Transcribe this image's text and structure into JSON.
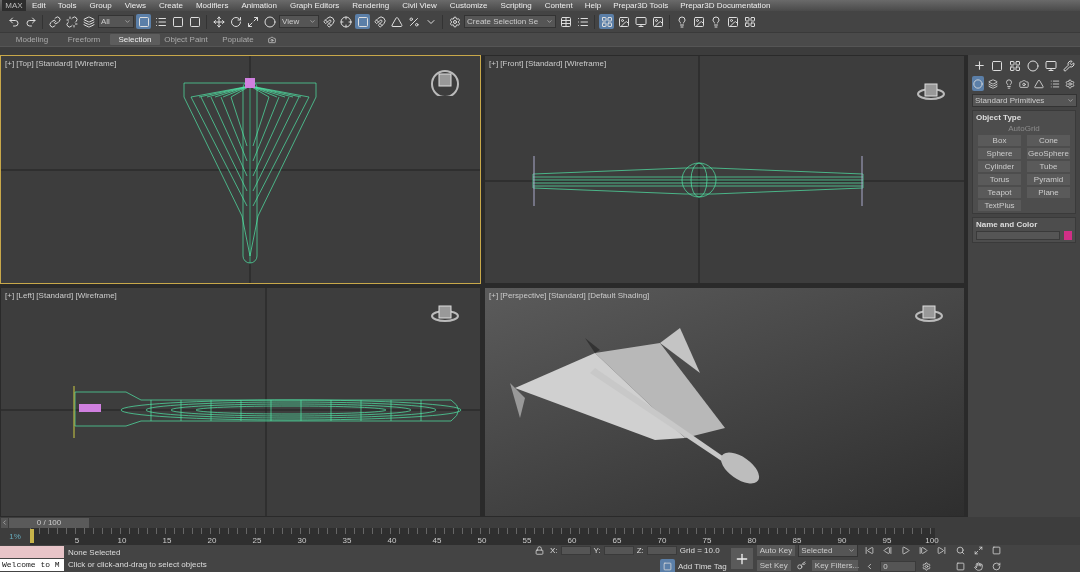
{
  "app_logo": "MAX",
  "menu": [
    "Edit",
    "Tools",
    "Group",
    "Views",
    "Create",
    "Modifiers",
    "Animation",
    "Graph Editors",
    "Rendering",
    "Civil View",
    "Customize",
    "Scripting",
    "Content",
    "Help",
    "Prepar3D Tools",
    "Prepar3D Documentation"
  ],
  "toolbar": {
    "selection_filter": "All",
    "reference_coordinate": "View",
    "named_selection": "Create Selection Se"
  },
  "ribbon_tabs": [
    {
      "label": "Modeling",
      "selected": false
    },
    {
      "label": "Freeform",
      "selected": false
    },
    {
      "label": "Selection",
      "selected": true
    },
    {
      "label": "Object Paint",
      "selected": false
    },
    {
      "label": "Populate",
      "selected": false
    }
  ],
  "viewports": [
    {
      "label": "[+] [Top] [Standard] [Wireframe]",
      "kind": "top",
      "selected": true
    },
    {
      "label": "[+] [Front] [Standard] [Wireframe]",
      "kind": "front",
      "selected": false
    },
    {
      "label": "[+] [Left] [Standard] [Wireframe]",
      "kind": "left",
      "selected": false
    },
    {
      "label": "[+] [Perspective] [Standard] [Default Shading]",
      "kind": "perspective",
      "selected": false
    }
  ],
  "command_panel": {
    "category": "Standard Primitives",
    "object_type": {
      "title": "Object Type",
      "autogrid": {
        "label": "AutoGrid",
        "disabled": true
      },
      "buttons": [
        "Box",
        "Cone",
        "Sphere",
        "GeoSphere",
        "Cylinder",
        "Tube",
        "Torus",
        "Pyramid",
        "Teapot",
        "Plane",
        "TextPlus"
      ]
    },
    "name_and_color": {
      "title": "Name and Color",
      "color": "#d02f86"
    }
  },
  "time_slider": {
    "label": "0 / 100"
  },
  "ruler": {
    "labels": [
      "5",
      "10",
      "15",
      "20",
      "25",
      "30",
      "35",
      "40",
      "45",
      "50",
      "55",
      "60",
      "65",
      "70",
      "75",
      "80",
      "85",
      "90",
      "95",
      "100"
    ],
    "percent": "1%"
  },
  "status": {
    "listener": "Welcome to M",
    "selection": "None Selected",
    "prompt": "Click or click-and-drag to select objects",
    "x_label": "X:",
    "y_label": "Y:",
    "z_label": "Z:",
    "grid": "Grid = 10.0",
    "add_time_tag": "Add Time Tag",
    "auto_key": "Auto Key",
    "set_key": "Set Key",
    "key_mode": "Selected",
    "key_filters": "Key Filters...",
    "current_frame": "0"
  }
}
